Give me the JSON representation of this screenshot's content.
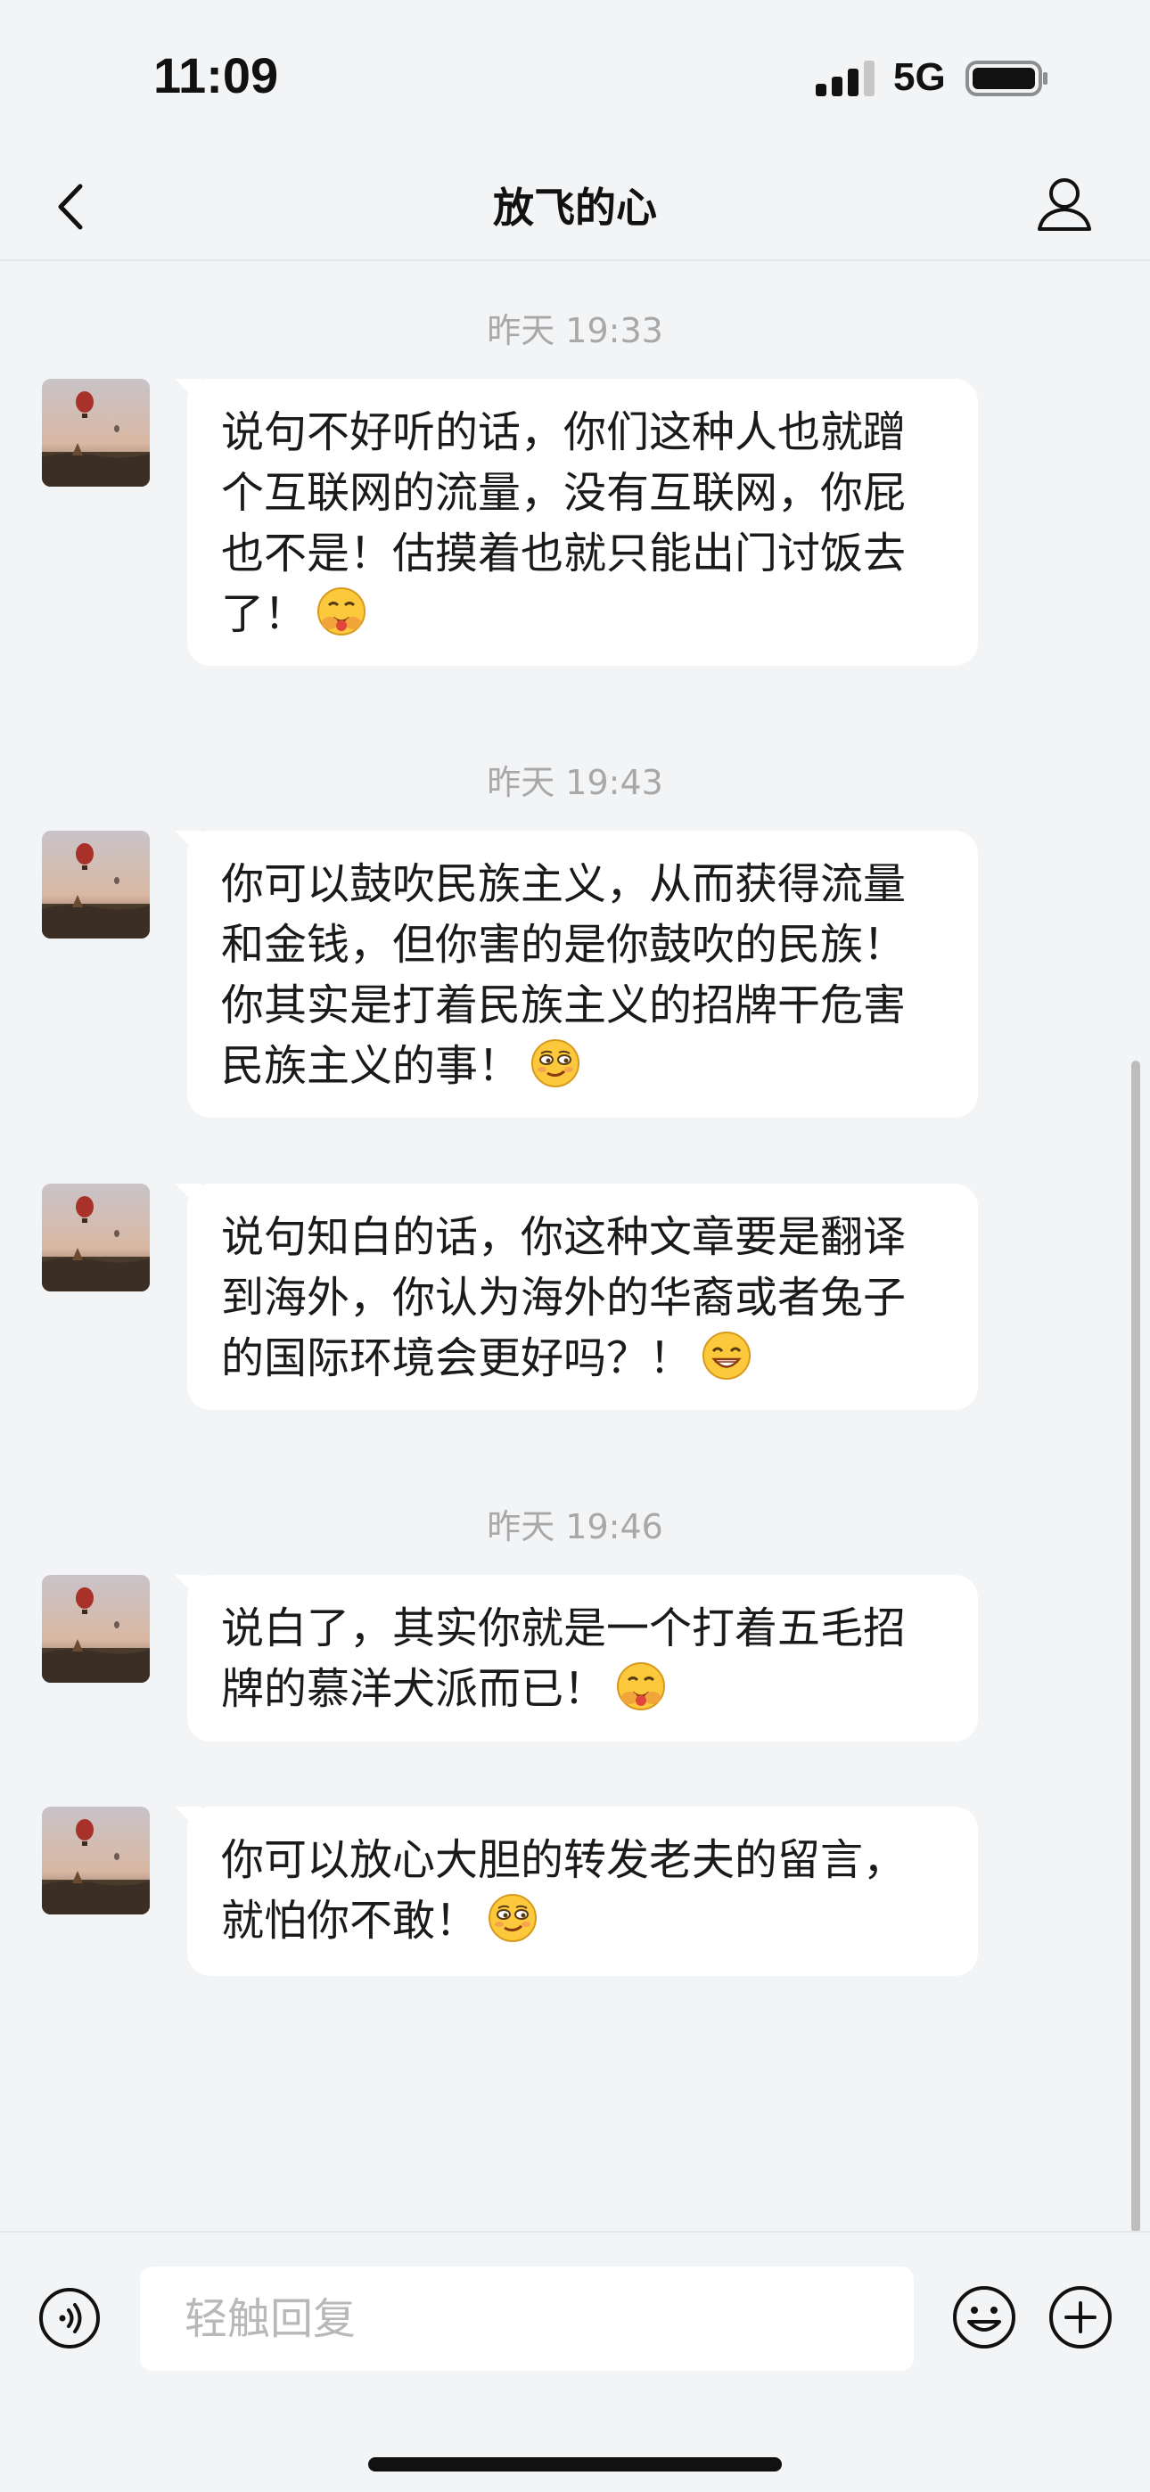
{
  "status_bar": {
    "time": "11:09",
    "network": "5G",
    "icons": [
      "signal-icon",
      "battery-icon"
    ]
  },
  "header": {
    "title": "放飞的心",
    "icons": [
      "back-chevron-icon",
      "profile-icon"
    ]
  },
  "conversation": [
    {
      "timestamp": "昨天 19:33",
      "messages": [
        {
          "text": "说句不好听的话，你们这种人也就蹭个互联网的流量，没有互联网，你屁也不是！估摸着也就只能出门讨饭去了！",
          "emoji": "hugging-face-emoji"
        }
      ]
    },
    {
      "timestamp": "昨天 19:43",
      "messages": [
        {
          "text": "你可以鼓吹民族主义，从而获得流量和金钱，但你害的是你鼓吹的民族！你其实是打着民族主义的招牌干危害民族主义的事！",
          "emoji": "smirk-face-emoji"
        },
        {
          "text": "说句知白的话，你这种文章要是翻译到海外，你认为海外的华裔或者兔子的国际环境会更好吗？！",
          "emoji": "grinning-face-emoji"
        }
      ]
    },
    {
      "timestamp": "昨天 19:46",
      "messages": [
        {
          "text": "说白了，其实你就是一个打着五毛招牌的慕洋犬派而已！",
          "emoji": "hugging-face-emoji"
        },
        {
          "text": "你可以放心大胆的转发老夫的留言，就怕你不敢！",
          "emoji": "smirk-face-emoji"
        }
      ]
    }
  ],
  "composer": {
    "placeholder": "轻触回复",
    "icons": [
      "voice-icon",
      "emoji-icon",
      "plus-icon"
    ]
  },
  "colors": {
    "background": "#f3f4f6",
    "bubble": "#ffffff",
    "timestamp_text": "#a8a8a8",
    "text": "#1a1a1a"
  }
}
